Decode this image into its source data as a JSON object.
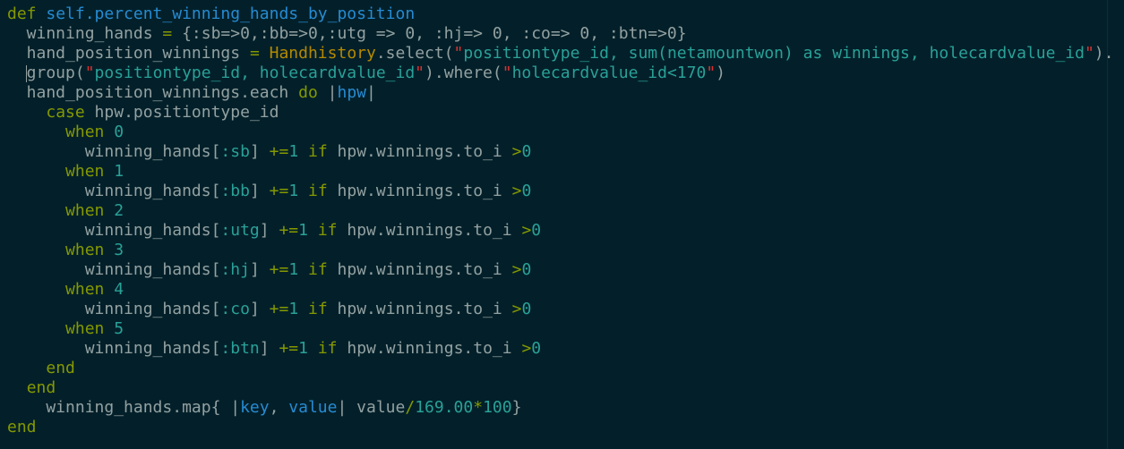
{
  "editor": {
    "colors": {
      "background": "#03202a",
      "text": "#93a1a1",
      "keyword": "#859900",
      "function": "#268bd2",
      "string": "#2aa198",
      "constant": "#b58900",
      "quote": "#dc322f"
    },
    "lines": [
      [
        {
          "t": "def",
          "c": "kw"
        },
        {
          "t": " self.percent_winning_hands_by_position",
          "c": "fn"
        }
      ],
      [
        {
          "t": "  winning_hands ",
          "c": "txt"
        },
        {
          "t": "=",
          "c": "op"
        },
        {
          "t": " {:sb=>0,:bb=>0,:utg => 0, :hj=> 0, :co=> 0, :btn=>0}",
          "c": "txt"
        }
      ],
      [
        {
          "t": "  hand_position_winnings ",
          "c": "txt"
        },
        {
          "t": "=",
          "c": "op"
        },
        {
          "t": " ",
          "c": "txt"
        },
        {
          "t": "Handhistory",
          "c": "const"
        },
        {
          "t": ".select(",
          "c": "txt"
        },
        {
          "t": "\"",
          "c": "q"
        },
        {
          "t": "positiontype_id, sum(netamountwon) as winnings, holecardvalue_id",
          "c": "str"
        },
        {
          "t": "\"",
          "c": "q"
        },
        {
          "t": ").",
          "c": "txt"
        }
      ],
      [
        {
          "t": "  group(",
          "c": "txt"
        },
        {
          "t": "\"",
          "c": "q"
        },
        {
          "t": "positiontype_id, holecardvalue_id",
          "c": "str"
        },
        {
          "t": "\"",
          "c": "q"
        },
        {
          "t": ").where(",
          "c": "txt"
        },
        {
          "t": "\"",
          "c": "q"
        },
        {
          "t": "holecardvalue_id<170",
          "c": "str"
        },
        {
          "t": "\"",
          "c": "q"
        },
        {
          "t": ")",
          "c": "txt"
        }
      ],
      [
        {
          "t": "  hand_position_winnings.each ",
          "c": "txt"
        },
        {
          "t": "do",
          "c": "kw"
        },
        {
          "t": " |",
          "c": "txt"
        },
        {
          "t": "hpw",
          "c": "var"
        },
        {
          "t": "|",
          "c": "txt"
        }
      ],
      [
        {
          "t": "    ",
          "c": "txt"
        },
        {
          "t": "case",
          "c": "kw"
        },
        {
          "t": " hpw.positiontype_id",
          "c": "txt"
        }
      ],
      [
        {
          "t": "      ",
          "c": "txt"
        },
        {
          "t": "when",
          "c": "kw"
        },
        {
          "t": " ",
          "c": "txt"
        },
        {
          "t": "0",
          "c": "num"
        }
      ],
      [
        {
          "t": "        winning_hands[",
          "c": "txt"
        },
        {
          "t": ":sb",
          "c": "sym"
        },
        {
          "t": "] ",
          "c": "txt"
        },
        {
          "t": "+=",
          "c": "op"
        },
        {
          "t": "1",
          "c": "num"
        },
        {
          "t": " ",
          "c": "txt"
        },
        {
          "t": "if",
          "c": "kw"
        },
        {
          "t": " hpw.winnings.to_i ",
          "c": "txt"
        },
        {
          "t": ">",
          "c": "op"
        },
        {
          "t": "0",
          "c": "num"
        }
      ],
      [
        {
          "t": "      ",
          "c": "txt"
        },
        {
          "t": "when",
          "c": "kw"
        },
        {
          "t": " ",
          "c": "txt"
        },
        {
          "t": "1",
          "c": "num"
        }
      ],
      [
        {
          "t": "        winning_hands[",
          "c": "txt"
        },
        {
          "t": ":bb",
          "c": "sym"
        },
        {
          "t": "] ",
          "c": "txt"
        },
        {
          "t": "+=",
          "c": "op"
        },
        {
          "t": "1",
          "c": "num"
        },
        {
          "t": " ",
          "c": "txt"
        },
        {
          "t": "if",
          "c": "kw"
        },
        {
          "t": " hpw.winnings.to_i ",
          "c": "txt"
        },
        {
          "t": ">",
          "c": "op"
        },
        {
          "t": "0",
          "c": "num"
        }
      ],
      [
        {
          "t": "      ",
          "c": "txt"
        },
        {
          "t": "when",
          "c": "kw"
        },
        {
          "t": " ",
          "c": "txt"
        },
        {
          "t": "2",
          "c": "num"
        }
      ],
      [
        {
          "t": "        winning_hands[",
          "c": "txt"
        },
        {
          "t": ":utg",
          "c": "sym"
        },
        {
          "t": "] ",
          "c": "txt"
        },
        {
          "t": "+=",
          "c": "op"
        },
        {
          "t": "1",
          "c": "num"
        },
        {
          "t": " ",
          "c": "txt"
        },
        {
          "t": "if",
          "c": "kw"
        },
        {
          "t": " hpw.winnings.to_i ",
          "c": "txt"
        },
        {
          "t": ">",
          "c": "op"
        },
        {
          "t": "0",
          "c": "num"
        }
      ],
      [
        {
          "t": "      ",
          "c": "txt"
        },
        {
          "t": "when",
          "c": "kw"
        },
        {
          "t": " ",
          "c": "txt"
        },
        {
          "t": "3",
          "c": "num"
        }
      ],
      [
        {
          "t": "        winning_hands[",
          "c": "txt"
        },
        {
          "t": ":hj",
          "c": "sym"
        },
        {
          "t": "] ",
          "c": "txt"
        },
        {
          "t": "+=",
          "c": "op"
        },
        {
          "t": "1",
          "c": "num"
        },
        {
          "t": " ",
          "c": "txt"
        },
        {
          "t": "if",
          "c": "kw"
        },
        {
          "t": " hpw.winnings.to_i ",
          "c": "txt"
        },
        {
          "t": ">",
          "c": "op"
        },
        {
          "t": "0",
          "c": "num"
        }
      ],
      [
        {
          "t": "      ",
          "c": "txt"
        },
        {
          "t": "when",
          "c": "kw"
        },
        {
          "t": " ",
          "c": "txt"
        },
        {
          "t": "4",
          "c": "num"
        }
      ],
      [
        {
          "t": "        winning_hands[",
          "c": "txt"
        },
        {
          "t": ":co",
          "c": "sym"
        },
        {
          "t": "] ",
          "c": "txt"
        },
        {
          "t": "+=",
          "c": "op"
        },
        {
          "t": "1",
          "c": "num"
        },
        {
          "t": " ",
          "c": "txt"
        },
        {
          "t": "if",
          "c": "kw"
        },
        {
          "t": " hpw.winnings.to_i ",
          "c": "txt"
        },
        {
          "t": ">",
          "c": "op"
        },
        {
          "t": "0",
          "c": "num"
        }
      ],
      [
        {
          "t": "      ",
          "c": "txt"
        },
        {
          "t": "when",
          "c": "kw"
        },
        {
          "t": " ",
          "c": "txt"
        },
        {
          "t": "5",
          "c": "num"
        }
      ],
      [
        {
          "t": "        winning_hands[",
          "c": "txt"
        },
        {
          "t": ":btn",
          "c": "sym"
        },
        {
          "t": "] ",
          "c": "txt"
        },
        {
          "t": "+=",
          "c": "op"
        },
        {
          "t": "1",
          "c": "num"
        },
        {
          "t": " ",
          "c": "txt"
        },
        {
          "t": "if",
          "c": "kw"
        },
        {
          "t": " hpw.winnings.to_i ",
          "c": "txt"
        },
        {
          "t": ">",
          "c": "op"
        },
        {
          "t": "0",
          "c": "num"
        }
      ],
      [
        {
          "t": "    ",
          "c": "txt"
        },
        {
          "t": "end",
          "c": "kw"
        }
      ],
      [
        {
          "t": "  ",
          "c": "txt"
        },
        {
          "t": "end",
          "c": "kw"
        }
      ],
      [
        {
          "t": "    winning_hands.map{ |",
          "c": "txt"
        },
        {
          "t": "key",
          "c": "var"
        },
        {
          "t": ", ",
          "c": "txt"
        },
        {
          "t": "value",
          "c": "var"
        },
        {
          "t": "| value",
          "c": "txt"
        },
        {
          "t": "/",
          "c": "op"
        },
        {
          "t": "169.00",
          "c": "num"
        },
        {
          "t": "*",
          "c": "op"
        },
        {
          "t": "100",
          "c": "num"
        },
        {
          "t": "}",
          "c": "txt"
        }
      ],
      [
        {
          "t": "end",
          "c": "kw"
        }
      ]
    ]
  }
}
